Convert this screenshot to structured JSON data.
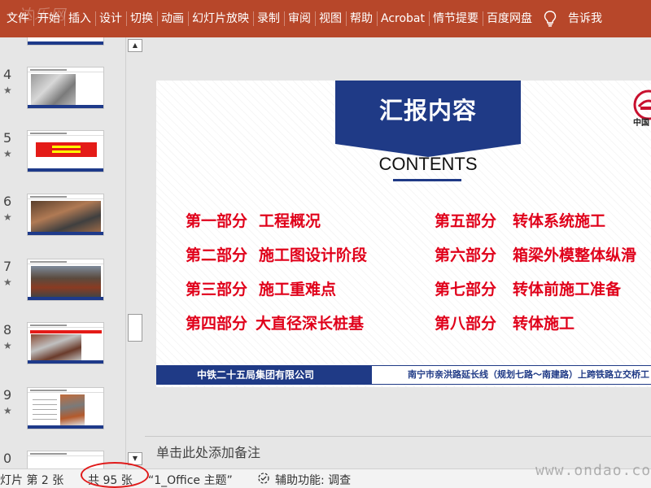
{
  "watermark_top": "‧达乐网",
  "ribbon": {
    "tabs": [
      "文件",
      "开始",
      "插入",
      "设计",
      "切换",
      "动画",
      "幻灯片放映",
      "录制",
      "审阅",
      "视图",
      "帮助",
      "Acrobat",
      "情节提要",
      "百度网盘"
    ],
    "tell_me": "告诉我",
    "bulb_icon": "lightbulb-icon"
  },
  "thumbnails": [
    {
      "number": "4",
      "star": "★"
    },
    {
      "number": "5",
      "star": "★"
    },
    {
      "number": "6",
      "star": "★"
    },
    {
      "number": "7",
      "star": "★"
    },
    {
      "number": "8",
      "star": "★"
    },
    {
      "number": "9",
      "star": "★"
    },
    {
      "number": "0",
      "star": ""
    }
  ],
  "slide": {
    "title": "汇报内容",
    "subtitle": "CONTENTS",
    "logo_text": "中国",
    "items": [
      {
        "part": "第一部分",
        "title": "工程概况"
      },
      {
        "part": "第二部分",
        "title": "施工图设计阶段"
      },
      {
        "part": "第三部分",
        "title": "施工重难点"
      },
      {
        "part": "第四部分",
        "title": "大直径深长桩基"
      },
      {
        "part": "第五部分",
        "title": "转体系统施工"
      },
      {
        "part": "第六部分",
        "title": "箱梁外模整体纵滑"
      },
      {
        "part": "第七部分",
        "title": "转体前施工准备"
      },
      {
        "part": "第八部分",
        "title": "转体施工"
      }
    ],
    "footer_left": "中铁二十五局集团有限公司",
    "footer_right": "南宁市亲洪路延长线（规划七路～南建路）上跨铁路立交桥工"
  },
  "notes_placeholder": "单击此处添加备注",
  "status": {
    "slide_position": "灯片 第 2 张",
    "total": "共 95 张",
    "theme": "“1_Office 主题”",
    "accessibility": "辅助功能: 调查"
  },
  "watermark_bottom": "www.ondao.com",
  "colors": {
    "ribbon": "#b7472a",
    "navy": "#1f3a86",
    "red_text": "#e0001a",
    "annotation": "#e01a1a"
  }
}
